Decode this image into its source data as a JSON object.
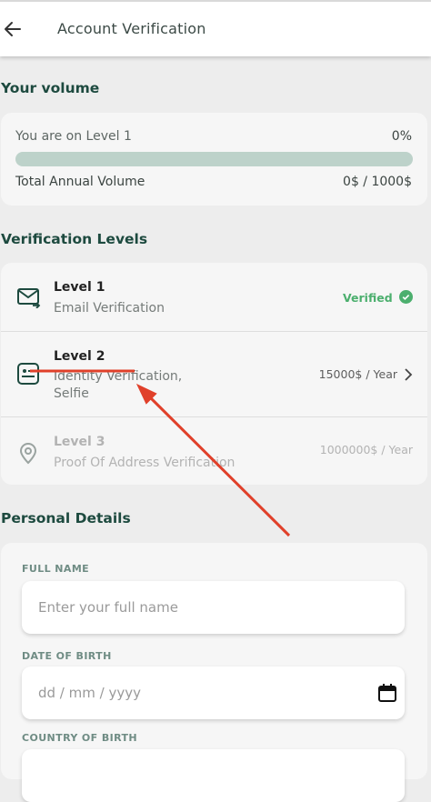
{
  "header": {
    "title": "Account Verification",
    "back_icon": "arrow-left-icon"
  },
  "volume": {
    "section_title": "Your volume",
    "level_text": "You are on Level 1",
    "percent_text": "0%",
    "progress_fraction": 0,
    "total_label": "Total Annual Volume",
    "total_value": "0$ / 1000$"
  },
  "verification": {
    "section_title": "Verification Levels",
    "levels": [
      {
        "name": "Level 1",
        "desc": "Email Verification",
        "status": "Verified",
        "icon": "email-icon"
      },
      {
        "name": "Level 2",
        "desc": "Identity Verification, Selfie",
        "limit": "15000$ / Year",
        "icon": "id-card-icon"
      },
      {
        "name": "Level 3",
        "desc": "Proof Of Address Verification",
        "limit": "1000000$ / Year",
        "icon": "location-pin-icon"
      }
    ]
  },
  "personal": {
    "section_title": "Personal Details",
    "full_name_label": "FULL NAME",
    "full_name_placeholder": "Enter your full name",
    "dob_label": "DATE OF BIRTH",
    "dob_placeholder": "dd / mm / yyyy",
    "country_label": "COUNTRY OF BIRTH"
  },
  "colors": {
    "brand": "#1d4a3f",
    "verified": "#4caf6e",
    "annotation": "#e0402a"
  }
}
